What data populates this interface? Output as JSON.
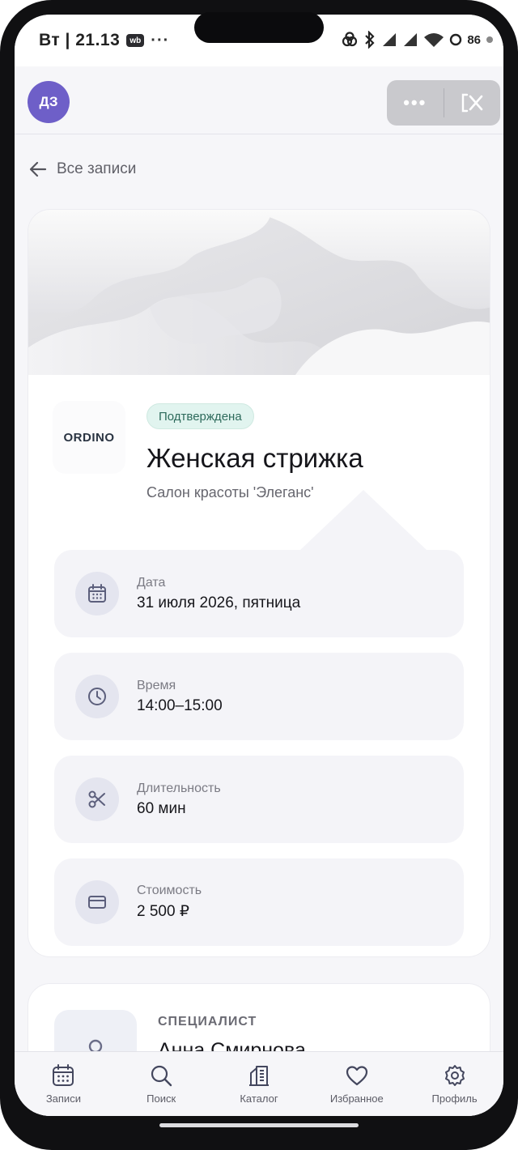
{
  "status_bar": {
    "time": "Вт | 21.13",
    "wb_badge": "wb",
    "overflow": "···",
    "battery": "86"
  },
  "header": {
    "avatar_initials": "ДЗ",
    "more_label": "•••"
  },
  "nav": {
    "back_label": "Все записи"
  },
  "booking": {
    "status": "Подтверждена",
    "logo_text": "ORDINO",
    "service": "Женская стрижка",
    "salon": "Салон красоты 'Элеганс'",
    "details": [
      {
        "label": "Дата",
        "value": "31 июля 2026, пятница",
        "icon": "calendar-icon"
      },
      {
        "label": "Время",
        "value": "14:00–15:00",
        "icon": "clock-icon"
      },
      {
        "label": "Длительность",
        "value": "60 мин",
        "icon": "scissors-icon"
      },
      {
        "label": "Стоимость",
        "value": "2 500 ₽",
        "icon": "card-icon"
      }
    ]
  },
  "specialist": {
    "section_label": "СПЕЦИАЛИСТ",
    "name": "Анна Смирнова"
  },
  "tabbar": {
    "items": [
      {
        "label": "Записи",
        "icon": "calendar-icon"
      },
      {
        "label": "Поиск",
        "icon": "search-icon"
      },
      {
        "label": "Каталог",
        "icon": "catalog-icon"
      },
      {
        "label": "Избранное",
        "icon": "heart-icon"
      },
      {
        "label": "Профиль",
        "icon": "gear-icon"
      }
    ]
  },
  "colors": {
    "avatar": "#6e5fc8",
    "status_badge_bg": "#e1f4ef",
    "status_badge_text": "#2d6a5b",
    "screen_bg": "#f6f6f9"
  }
}
